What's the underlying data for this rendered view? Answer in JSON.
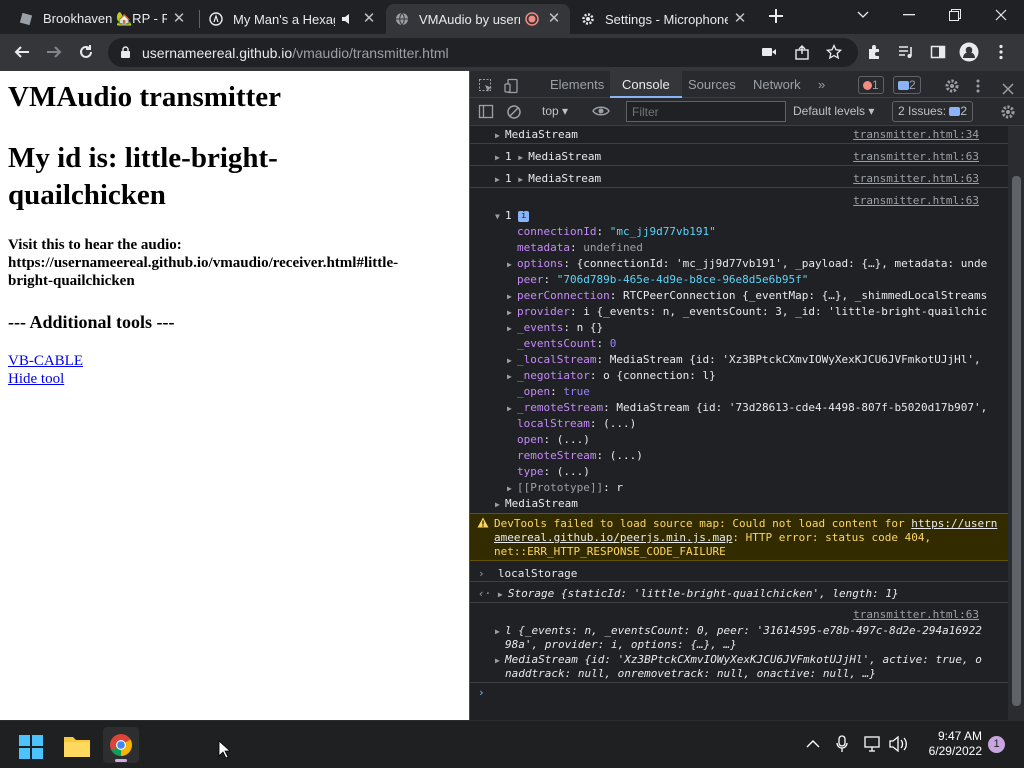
{
  "browser": {
    "tabs": [
      {
        "title": "Brookhaven 🏡RP - Ro",
        "icon": "roblox-icon"
      },
      {
        "title": "My Man's a Hexago",
        "icon": "site-icon"
      },
      {
        "title": "VMAudio by usern",
        "icon": "globe-icon"
      },
      {
        "title": "Settings - Microphone",
        "icon": "gear-icon"
      }
    ],
    "url_host": "usernameereal.github.io",
    "url_path": "/vmaudio/transmitter.html"
  },
  "page": {
    "title": "VMAudio transmitter",
    "id_line": "My id is: little-bright-quailchicken",
    "visit_line": "Visit this to hear the audio: https://usernameereal.github.io/vmaudio/receiver.html#little-bright-quailchicken",
    "tools_heading": "--- Additional tools ---",
    "link_vbcable": "VB-CABLE",
    "link_hide": "Hide tool"
  },
  "devtools": {
    "tabs": [
      "Elements",
      "Console",
      "Sources",
      "Network"
    ],
    "error_count": "1",
    "message_count": "2",
    "context": "top",
    "filter_placeholder": "Filter",
    "levels": "Default levels",
    "issues_label": "2 Issues:",
    "issues_count": "2",
    "console": {
      "mediastream": "MediaStream",
      "src34": "transmitter.html:34",
      "src63": "transmitter.html:63",
      "count1": "1",
      "obj_count": "1",
      "connectionId_k": "connectionId",
      "connectionId_v": "\"mc_jj9d77vb191\"",
      "metadata_k": "metadata",
      "metadata_v": "undefined",
      "options_k": "options",
      "options_v": "{connectionId: 'mc_jj9d77vb191', _payload: {…}, metadata: unde",
      "peer_k": "peer",
      "peer_v": "\"706d789b-465e-4d9e-b8ce-96e8d5e6b95f\"",
      "peerConnection_k": "peerConnection",
      "peerConnection_v": "RTCPeerConnection {_eventMap: {…}, _shimmedLocalStreams",
      "provider_k": "provider",
      "provider_v": "i {_events: n, _eventsCount: 3, _id: 'little-bright-quailchic",
      "events_k": "_events",
      "events_v": "n {}",
      "eventsCount_k": "_eventsCount",
      "eventsCount_v": "0",
      "localStream_k": "_localStream",
      "localStream_v": "MediaStream {id: 'Xz3BPtckCXmvIOWyXexKJCU6JVFmkotUJjHl',",
      "negotiator_k": "_negotiator",
      "negotiator_v": "o {connection: l}",
      "open_k": "_open",
      "open_v": "true",
      "remoteStream_k": "_remoteStream",
      "remoteStream_v": "MediaStream {id: '73d28613-cde4-4498-807f-b5020d17b907',",
      "localStream2_k": "localStream",
      "open2_k": "open",
      "remoteStream2_k": "remoteStream",
      "type_k": "type",
      "getter_v": "(...)",
      "proto_k": "[[Prototype]]",
      "proto_v": "r",
      "warning_1": "DevTools failed to load source map: Could not load content for ",
      "warning_link": "https://usernameereal.github.io/peerjs.min.js.map",
      "warning_2": ": HTTP error: status code 404, net::ERR_HTTP_RESPONSE_CODE_FAILURE",
      "cmd": "localStorage",
      "storage_result": "Storage {staticId: 'little-bright-quailchicken', length: 1}",
      "lobj_1": "l {_events: n, _eventsCount: 0, peer: '31614595-e78b-497c-8d2e-294a16922",
      "lobj_2": "98a', provider: i, options: {…}, …}",
      "ms_1": "MediaStream {id: 'Xz3BPtckCXmvIOWyXexKJCU6JVFmkotUJjHl', active: true, o",
      "ms_2": "naddtrack: null, onremovetrack: null, onactive: null, …}"
    }
  },
  "taskbar": {
    "time": "9:47 AM",
    "date": "6/29/2022",
    "notif": "1"
  },
  "colors": {
    "accent": "#8ab4f8",
    "warning_bg": "#332b00",
    "warning_text": "#fdd663"
  }
}
